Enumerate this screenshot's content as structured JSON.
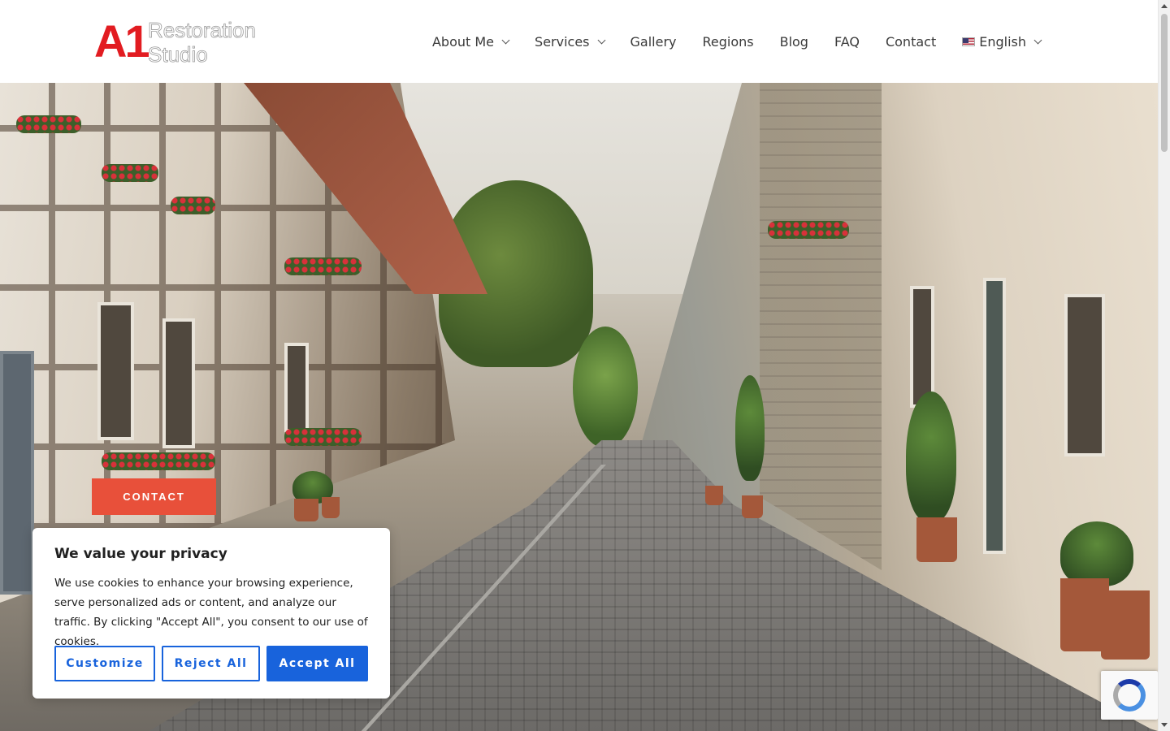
{
  "logo": {
    "mark": "A1",
    "line1": "Restoration",
    "line2": "Studio"
  },
  "nav": {
    "items": [
      {
        "label": "About Me",
        "dropdown": true
      },
      {
        "label": "Services",
        "dropdown": true
      },
      {
        "label": "Gallery",
        "dropdown": false
      },
      {
        "label": "Regions",
        "dropdown": false
      },
      {
        "label": "Blog",
        "dropdown": false
      },
      {
        "label": "FAQ",
        "dropdown": false
      },
      {
        "label": "Contact",
        "dropdown": false
      }
    ],
    "language": {
      "label": "English",
      "icon": "us-flag-icon"
    }
  },
  "hero": {
    "image": "cobblestone-street-half-timbered-houses",
    "cta_label": "CONTACT"
  },
  "cookie": {
    "title": "We value your privacy",
    "body": "We use cookies to enhance your browsing experience, serve personalized ads or content, and analyze our traffic. By clicking \"Accept All\", you consent to our use of cookies.",
    "customize": "Customize",
    "reject": "Reject All",
    "accept": "Accept All"
  },
  "colors": {
    "brand_red": "#e21c21",
    "cta_orange": "#e8503a",
    "cookie_blue": "#1863dc"
  },
  "recaptcha": {
    "icon": "recaptcha-icon"
  }
}
